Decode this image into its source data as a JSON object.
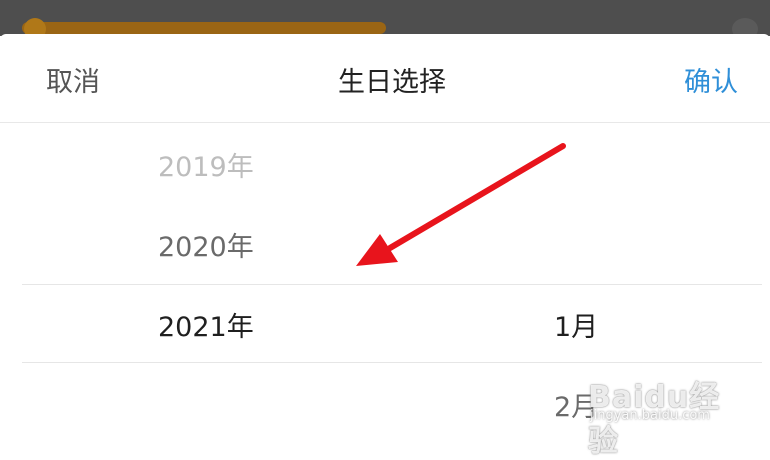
{
  "header": {
    "cancel_label": "取消",
    "title": "生日选择",
    "confirm_label": "确认"
  },
  "picker": {
    "year_options": [
      "2019年",
      "2020年",
      "2021年"
    ],
    "selected_year": "2021年",
    "month_options": [
      "1月",
      "2月"
    ],
    "selected_month": "1月"
  },
  "watermark": {
    "logo": "Baidu经验",
    "url": "jingyan.baidu.com"
  },
  "colors": {
    "accent": "#2f8fd8",
    "annotation_arrow": "#e8141c"
  }
}
